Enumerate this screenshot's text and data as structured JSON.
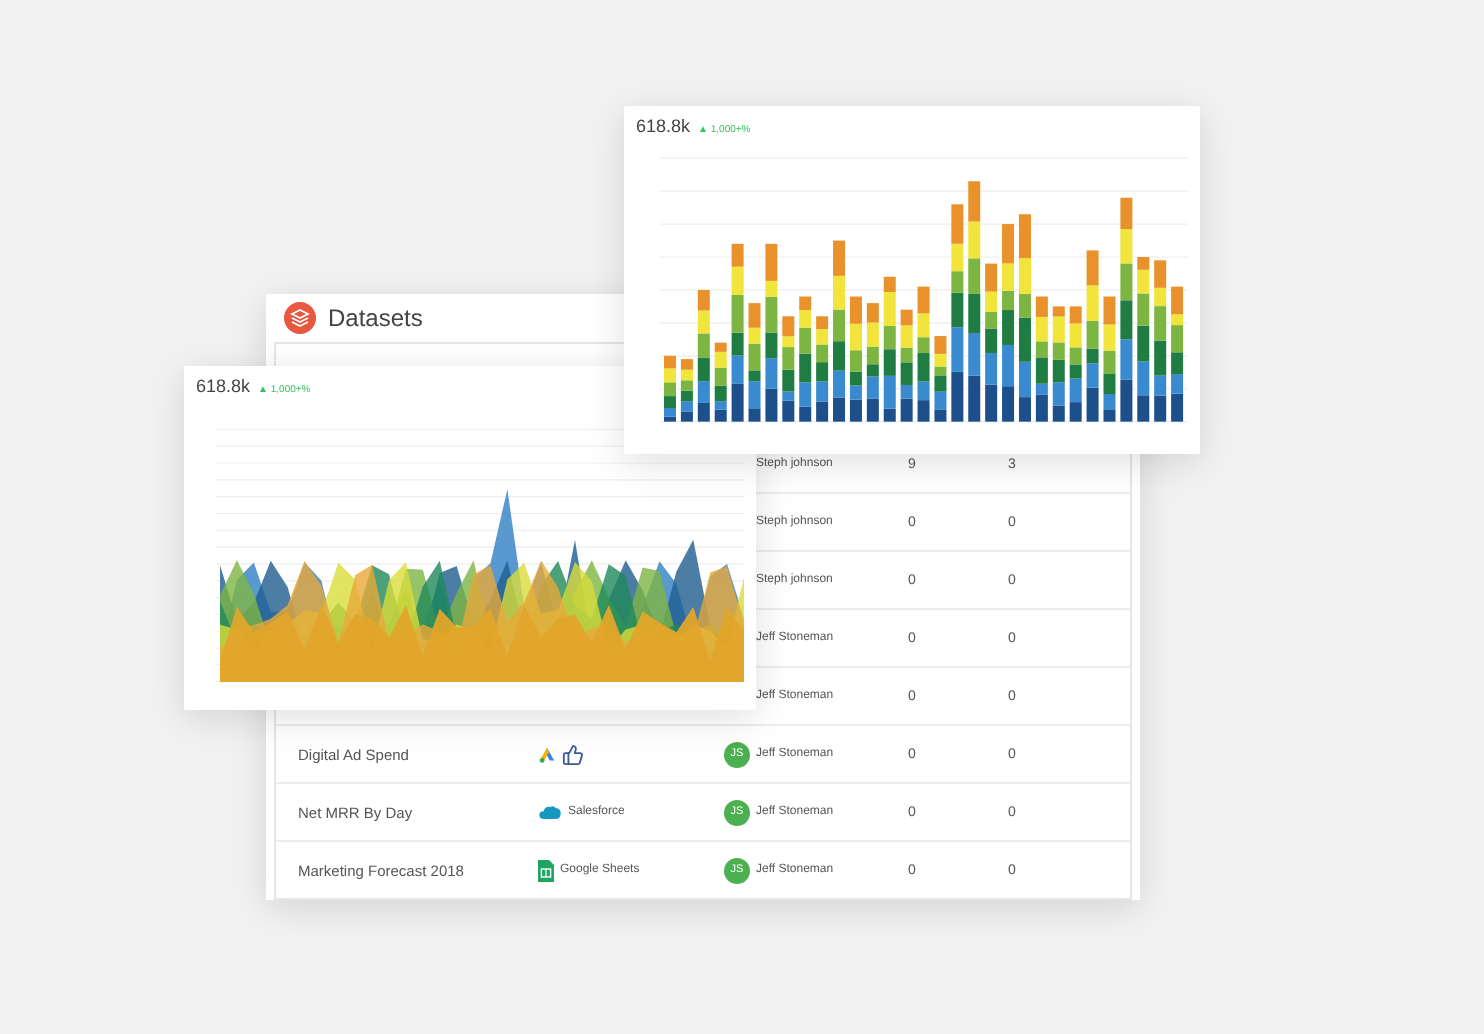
{
  "bar_card": {
    "value": "618.8k",
    "change": "▲ 1,000+%"
  },
  "area_card": {
    "value": "618.8k",
    "change": "▲ 1,000+%"
  },
  "datasets": {
    "title": "Datasets",
    "rows": [
      {
        "owner": {
          "name": "Steph johnson"
        },
        "count_1": "9",
        "count_2": "3"
      },
      {
        "owner": {
          "name": "Steph johnson"
        },
        "count_1": "0",
        "count_2": "0"
      },
      {
        "owner": {
          "name": "Steph johnson"
        },
        "count_1": "0",
        "count_2": "0"
      },
      {
        "owner": {
          "name": "Jeff Stoneman"
        },
        "count_1": "0",
        "count_2": "0"
      },
      {
        "owner": {
          "name": "Jeff Stoneman"
        },
        "count_1": "0",
        "count_2": "0"
      },
      {
        "name": "Digital Ad Spend",
        "sources": [
          {
            "kind": "ads"
          },
          {
            "kind": "social"
          }
        ],
        "owner": {
          "initials": "JS",
          "name": "Jeff Stoneman"
        },
        "count_1": "0",
        "count_2": "0"
      },
      {
        "name": "Net MRR By Day",
        "sources": [
          {
            "kind": "crm",
            "label": "Salesforce"
          }
        ],
        "owner": {
          "initials": "JS",
          "name": "Jeff Stoneman"
        },
        "count_1": "0",
        "count_2": "0"
      },
      {
        "name": "Marketing Forecast 2018",
        "sources": [
          {
            "kind": "sheet",
            "label": "Google Sheets"
          }
        ],
        "owner": {
          "initials": "JS",
          "name": "Jeff Stoneman"
        },
        "count_1": "0",
        "count_2": "0"
      }
    ]
  }
}
